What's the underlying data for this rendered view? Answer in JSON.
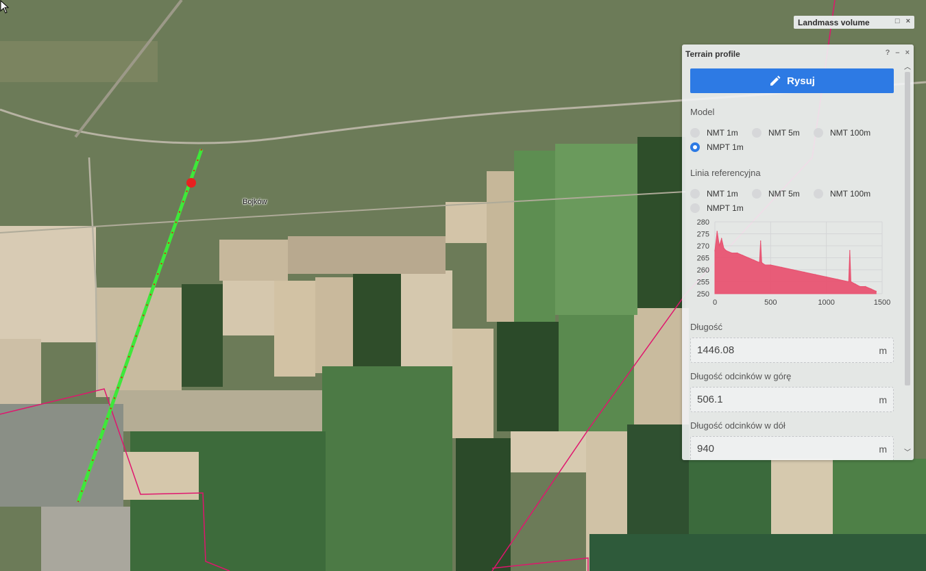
{
  "map": {
    "place_label": "Bojków"
  },
  "landmass_panel": {
    "title": "Landmass volume",
    "maximize_icon": "□",
    "close_icon": "×"
  },
  "terrain_panel": {
    "title": "Terrain profile",
    "help_icon": "?",
    "minimize_icon": "–",
    "close_icon": "×",
    "draw_button": "Rysuj",
    "model_label": "Model",
    "model_options": [
      "NMT 1m",
      "NMT 5m",
      "NMT 100m",
      "NMPT 1m"
    ],
    "model_selected": "NMPT 1m",
    "reference_label": "Linia referencyjna",
    "reference_options": [
      "NMT 1m",
      "NMT 5m",
      "NMT 100m",
      "NMPT 1m"
    ],
    "length_label": "Długość",
    "length_value": "1446.08",
    "length_unit": "m",
    "up_label": "Długość odcinków w górę",
    "up_value": "506.1",
    "up_unit": "m",
    "down_label": "Długość odcinków w dół",
    "down_value": "940",
    "down_unit": "m"
  },
  "colors": {
    "accent": "#2d7ae4",
    "profile_fill": "#e8506f",
    "boundary": "#e0156e",
    "track_green": "#3ee83a",
    "track_red": "#e01818"
  },
  "chart_data": {
    "type": "area",
    "title": "",
    "xlabel": "",
    "ylabel": "",
    "xlim": [
      0,
      1500
    ],
    "ylim": [
      250,
      280
    ],
    "x_ticks": [
      "0",
      "500",
      "1000",
      "1500"
    ],
    "y_ticks": [
      "280",
      "275",
      "270",
      "265",
      "260",
      "255",
      "250"
    ],
    "grid": true,
    "series": [
      {
        "x": [
          0,
          20,
          40,
          60,
          80,
          100,
          150,
          200,
          250,
          300,
          350,
          400,
          410,
          420,
          450,
          500,
          600,
          700,
          800,
          900,
          1000,
          1100,
          1200,
          1210,
          1220,
          1260,
          1300,
          1350,
          1400,
          1446
        ],
        "y": [
          268,
          276,
          270,
          273,
          269,
          268,
          267,
          267,
          266,
          265,
          264,
          263,
          272,
          263,
          262,
          262,
          261,
          260,
          259,
          258,
          257,
          256,
          255,
          268,
          255,
          254,
          253,
          253,
          252,
          251
        ]
      }
    ]
  }
}
